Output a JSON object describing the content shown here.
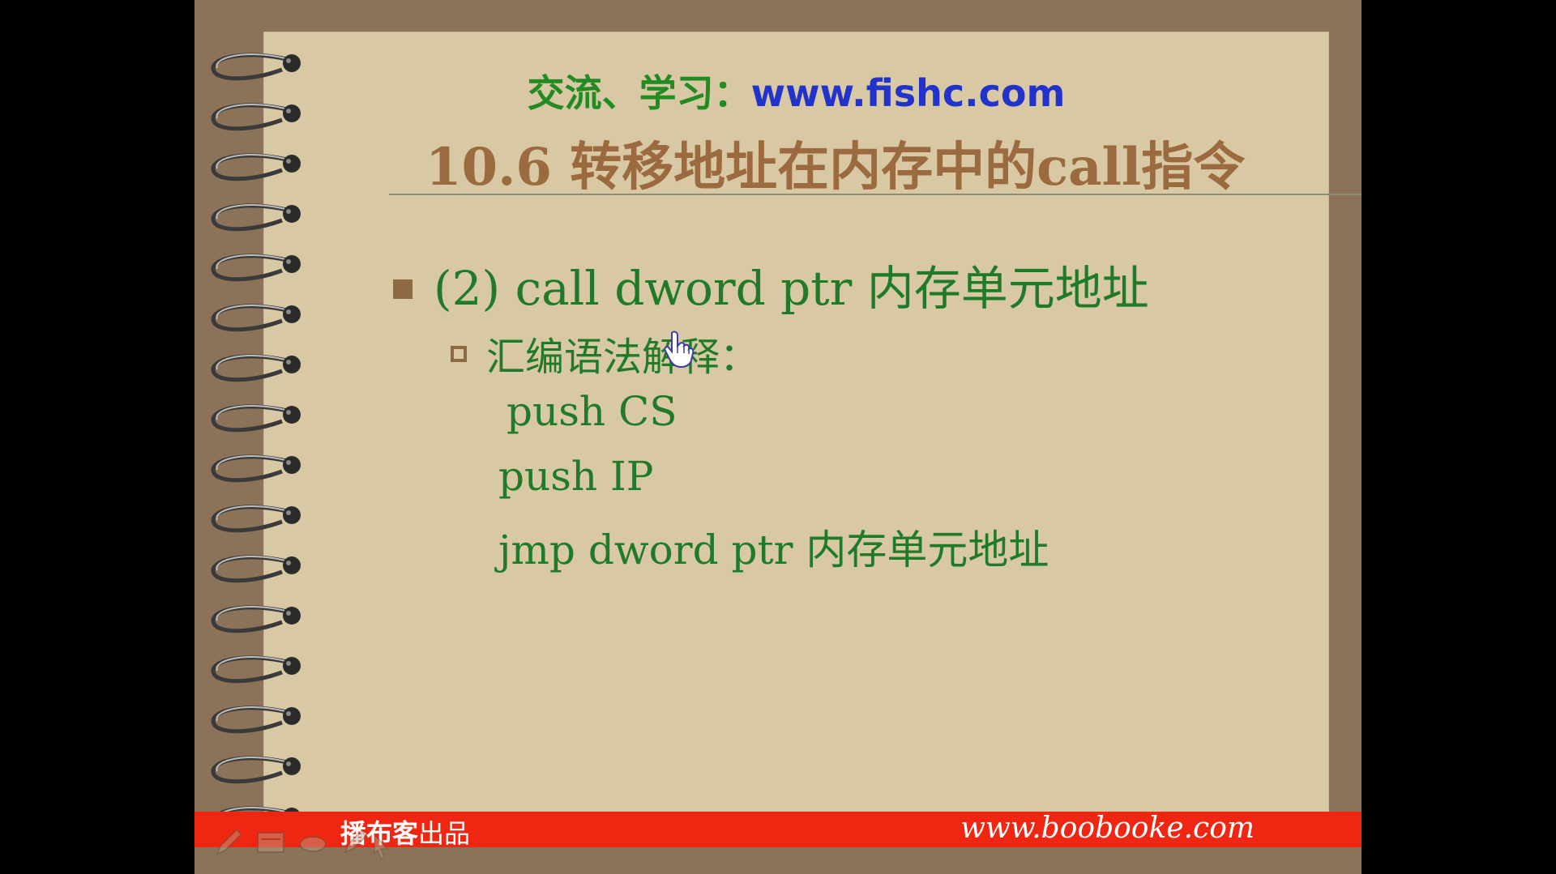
{
  "header": {
    "prefix": "交流、学习：",
    "url": "www.fishc.com"
  },
  "slide": {
    "title": "10.6 转移地址在内存中的call指令",
    "level1": "(2) call dword ptr 内存单元地址",
    "level2": "汇编语法解释：",
    "code": [
      "push CS",
      "push IP",
      "jmp dword ptr 内存单元地址"
    ]
  },
  "footer": {
    "brand_bold": "播布客",
    "brand_suffix": "出品",
    "url": "www.boobooke.com"
  },
  "icons": {
    "spiral": "spiral-binding-icon",
    "cursor": "hand-cursor-icon",
    "pen": "pen-icon",
    "slides": "slides-icon",
    "eraser": "eraser-icon",
    "highlighter": "highlighter-icon",
    "pointer": "arrow-pointer-icon"
  },
  "colors": {
    "frame": "#8b7258",
    "paper": "#d8c8a4",
    "green_text": "#1f7a2a",
    "title_brown": "#9b6a3e",
    "url_blue": "#2233cc",
    "footer_red": "#ef2611"
  }
}
